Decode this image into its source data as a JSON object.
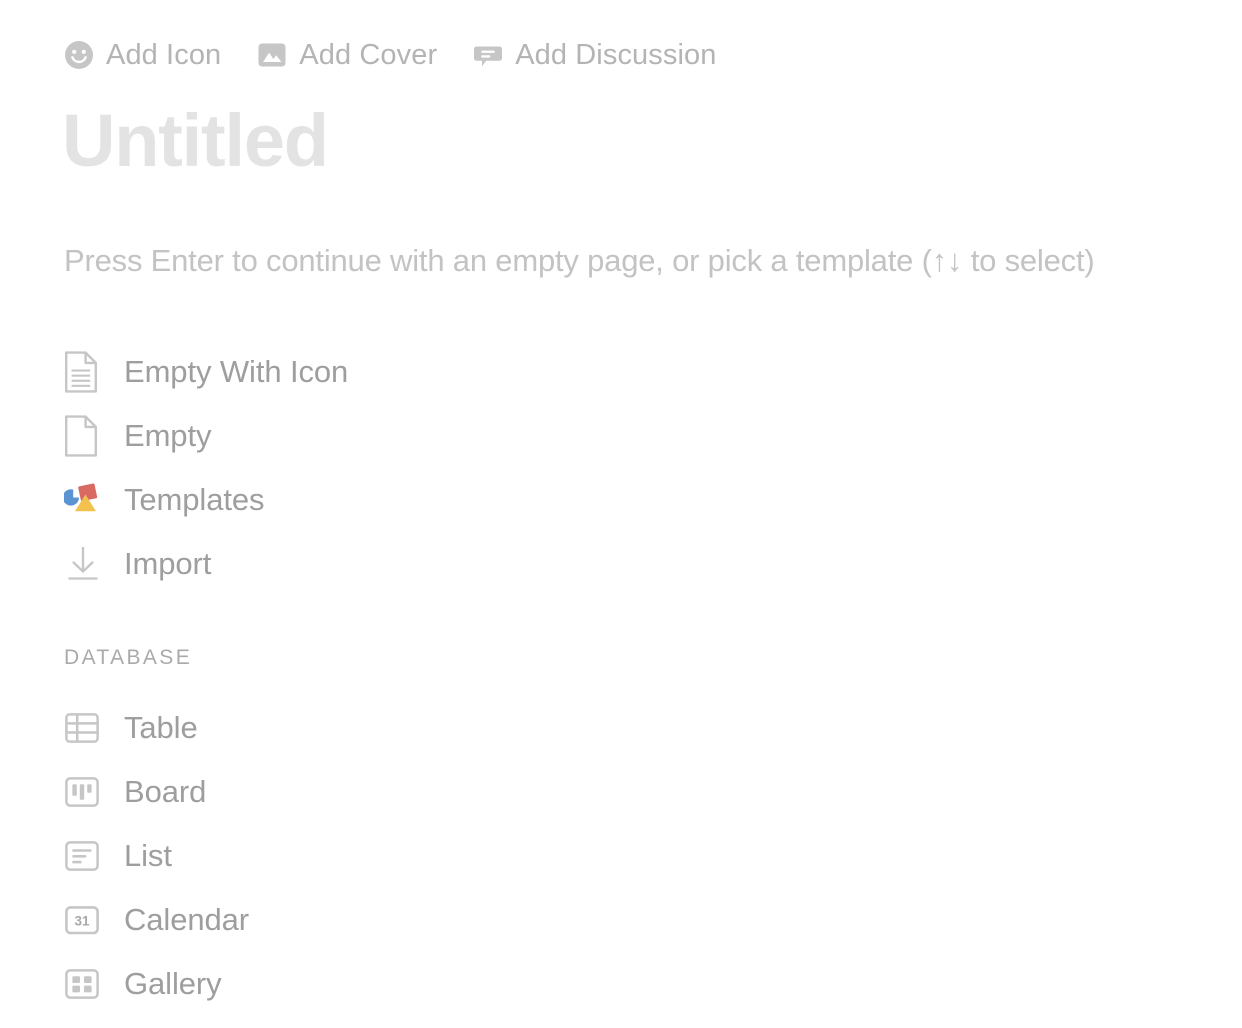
{
  "page": {
    "title_placeholder": "Untitled",
    "hint": "Press Enter to continue with an empty page, or pick a template (↑↓ to select)"
  },
  "actions": [
    {
      "label": "Add Icon",
      "icon": "smiley-icon"
    },
    {
      "label": "Add Cover",
      "icon": "image-icon"
    },
    {
      "label": "Add Discussion",
      "icon": "comment-icon"
    }
  ],
  "templates": [
    {
      "label": "Empty With Icon",
      "icon": "document-lines-icon"
    },
    {
      "label": "Empty",
      "icon": "document-blank-icon"
    },
    {
      "label": "Templates",
      "icon": "templates-shapes-icon"
    },
    {
      "label": "Import",
      "icon": "download-arrow-icon"
    }
  ],
  "database_section": {
    "heading": "Database",
    "items": [
      {
        "label": "Table",
        "icon": "table-grid-icon"
      },
      {
        "label": "Board",
        "icon": "board-columns-icon"
      },
      {
        "label": "List",
        "icon": "list-lines-icon"
      },
      {
        "label": "Calendar",
        "icon": "calendar-31-icon",
        "day": "31"
      },
      {
        "label": "Gallery",
        "icon": "gallery-grid-icon"
      }
    ]
  },
  "colors": {
    "title_placeholder": "#e3e3e3",
    "hint_text": "#c3c3c3",
    "item_text": "#9e9e9e",
    "action_text": "#b4b4b4",
    "icon_gray": "#c6c6c6",
    "section_heading": "#aaaaaa",
    "templates_blue": "#5b93d3",
    "templates_red": "#d96a62",
    "templates_yellow": "#f2c14e",
    "background": "#ffffff"
  }
}
